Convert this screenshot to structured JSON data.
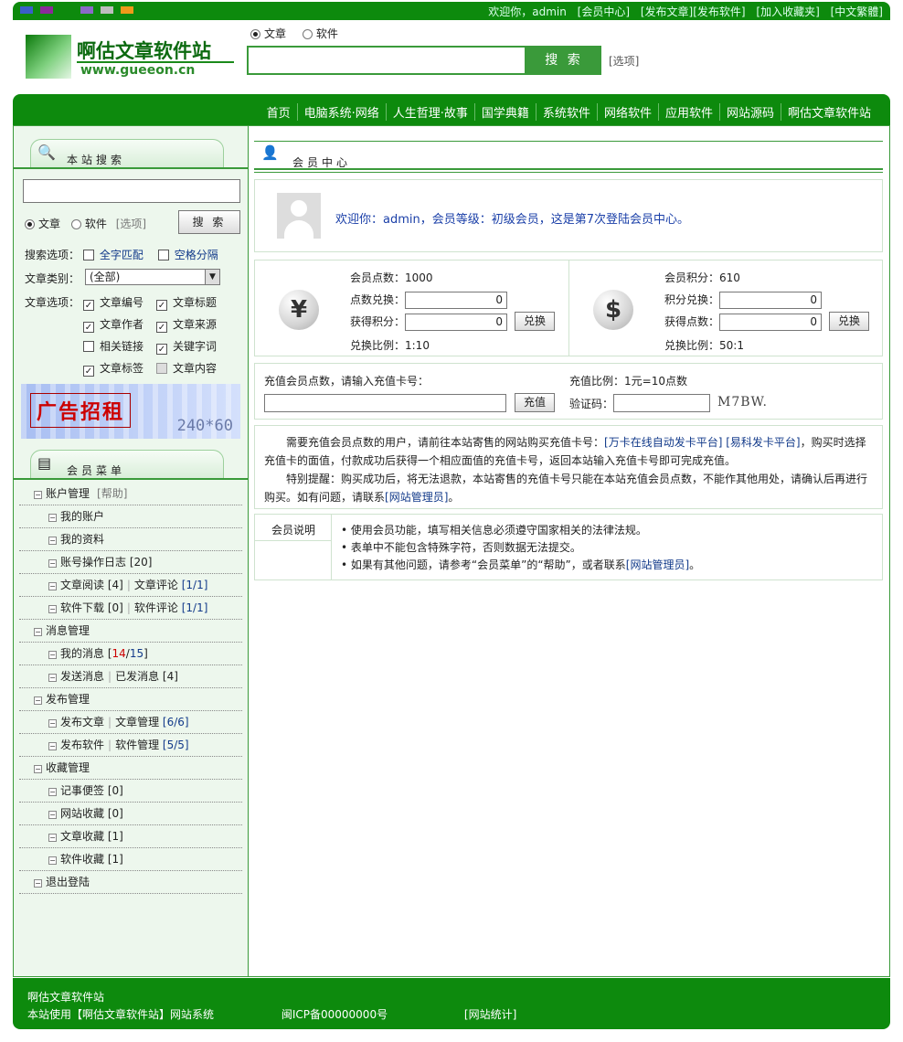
{
  "colors": {
    "brand": "#0d8a0d",
    "link": "#123a8a",
    "accent_red": "#c00000"
  },
  "topbar": {
    "swatches": [
      "#3a5fc8",
      "#8a2a9a",
      "#8a6ac8",
      "#bdbdbd",
      "#f09a1a"
    ],
    "welcome": "欢迎你，admin",
    "links": [
      "[会员中心]",
      "[发布文章][发布软件]",
      "[加入收藏夹]",
      "[中文繁體]"
    ]
  },
  "header": {
    "logo_title": "啊估文章软件站",
    "logo_url": "www.gueeon.cn",
    "radio_article": "文章",
    "radio_software": "软件",
    "search_value": "",
    "search_button": "搜 索",
    "options_link": "[选项]"
  },
  "nav": [
    "首页",
    "电脑系统·网络",
    "人生哲理·故事",
    "国学典籍",
    "系统软件",
    "网络软件",
    "应用软件",
    "网站源码",
    "啊估文章软件站"
  ],
  "sidebar": {
    "search_tab": "本站搜索",
    "search_value": "",
    "radio_article": "文章",
    "radio_software": "软件",
    "options_link": "[选项]",
    "search_button": "搜 索",
    "search_options_label": "搜索选项：",
    "full_match": "全字匹配",
    "space_split": "空格分隔",
    "category_label": "文章类别：",
    "category_value": "(全部)",
    "article_options_label": "文章选项：",
    "opt_id": "文章编号",
    "opt_title": "文章标题",
    "opt_author": "文章作者",
    "opt_source": "文章来源",
    "opt_links": "相关链接",
    "opt_keywords": "关键字词",
    "opt_tags": "文章标签",
    "opt_content": "文章内容",
    "ad_text": "广告招租",
    "ad_size": "240*60",
    "menu_tab": "会员菜单",
    "menu": {
      "account": "账户管理",
      "help": "[帮助]",
      "my_account": "我的账户",
      "my_profile": "我的资料",
      "account_log": "账号操作日志",
      "account_log_count": "[20]",
      "article_read": "文章阅读",
      "article_read_count": "[4]",
      "article_comment": "文章评论",
      "article_comment_count": "[1/1]",
      "soft_download": "软件下载",
      "soft_download_count": "[0]",
      "soft_comment": "软件评论",
      "soft_comment_count": "[1/1]",
      "messages": "消息管理",
      "my_messages": "我的消息",
      "my_messages_new": "14",
      "my_messages_total": "15",
      "send_message": "发送消息",
      "sent_messages": "已发消息",
      "sent_count": "[4]",
      "publish": "发布管理",
      "publish_article": "发布文章",
      "manage_article": "文章管理",
      "manage_article_count": "[6/6]",
      "publish_soft": "发布软件",
      "manage_soft": "软件管理",
      "manage_soft_count": "[5/5]",
      "favorites": "收藏管理",
      "notes": "记事便签",
      "notes_count": "[0]",
      "site_fav": "网站收藏",
      "site_fav_count": "[0]",
      "article_fav": "文章收藏",
      "article_fav_count": "[1]",
      "soft_fav": "软件收藏",
      "soft_fav_count": "[1]",
      "logout": "退出登陆"
    }
  },
  "main": {
    "tab_title": "会员中心",
    "welcome_text": "欢迎你：admin，会员等级：初级会员，这是第7次登陆会员中心。",
    "points": {
      "points_label": "会员点数：1000",
      "points_exchange_label": "点数兑换：",
      "points_exchange_value": "0",
      "get_score_label": "获得积分：",
      "get_score_value": "0",
      "exchange_button": "兑换",
      "ratio_left": "兑换比例：1:10",
      "score_label": "会员积分：610",
      "score_exchange_label": "积分兑换：",
      "score_exchange_value": "0",
      "get_points_label": "获得点数：",
      "get_points_value": "0",
      "ratio_right": "兑换比例：50:1"
    },
    "recharge": {
      "label": "充值会员点数，请输入充值卡号：",
      "card_value": "",
      "button": "充值",
      "ratio": "充值比例：1元=10点数",
      "captcha_label": "验证码：",
      "captcha_value": "",
      "captcha_text": "M7BW."
    },
    "info": {
      "p1_a": "需要充值会员点数的用户，请前往本站寄售的网站购买充值卡号：",
      "link1": "[万卡在线自动发卡平台]",
      "link2": "[易科发卡平台]",
      "p1_b": "，购买时选择充值卡的面值，付款成功后获得一个相应面值的充值卡号，返回本站输入充值卡号即可完成充值。",
      "p2_a": "特别提醒：购买成功后，将无法退款，本站寄售的充值卡号只能在本站充值会员点数，不能作其他用处，请确认后再进行购买。如有问题，请联系",
      "link3": "[网站管理员]",
      "p2_b": "。"
    },
    "notes": {
      "label": "会员说明",
      "item1": "使用会员功能，填写相关信息必须遵守国家相关的法律法规。",
      "item2": "表单中不能包含特殊字符，否则数据无法提交。",
      "item3_a": "如果有其他问题，请参考“会员菜单”的“帮助”，或者联系",
      "item3_link": "[网站管理员]",
      "item3_b": "。"
    }
  },
  "footer": {
    "site_name": "啊估文章软件站",
    "powered": "本站使用【啊估文章软件站】网站系统",
    "icp": "闽ICP备00000000号",
    "stats": "[网站统计]"
  }
}
